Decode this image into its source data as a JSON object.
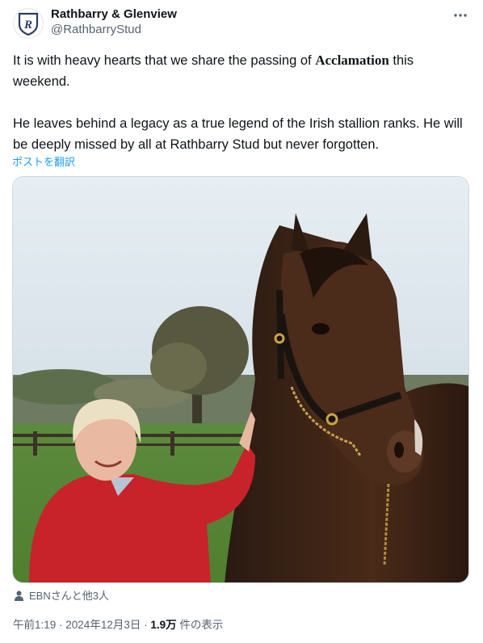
{
  "account": {
    "name": "Rathbarry & Glenview",
    "handle": "@RathbarryStud",
    "avatar_icon": "stud-shield-logo-icon"
  },
  "more_icon": "ellipsis-icon",
  "tweet": {
    "line1_before": "It is with heavy hearts that we share the passing of ",
    "line1_bold": "Acclamation",
    "line1_after": " this\nweekend.\n\nHe leaves behind a legacy as a true legend of the Irish stallion ranks. He will be deeply missed by all at Rathbarry Stud but never forgotten."
  },
  "translate_label": "ポストを翻訳",
  "media": {
    "description_icon": "photo-woman-with-horse"
  },
  "likers": {
    "icon": "person-icon",
    "text": "EBNさんと他3人"
  },
  "meta": {
    "time": "午前1:19",
    "sep1": " · ",
    "date": "2024年12月3日",
    "sep2": " · ",
    "views_count": "1.9万",
    "views_label": " 件の表示"
  },
  "colors": {
    "link": "#1d9bf0",
    "secondary": "#536471",
    "primary_text": "#0f1419"
  }
}
